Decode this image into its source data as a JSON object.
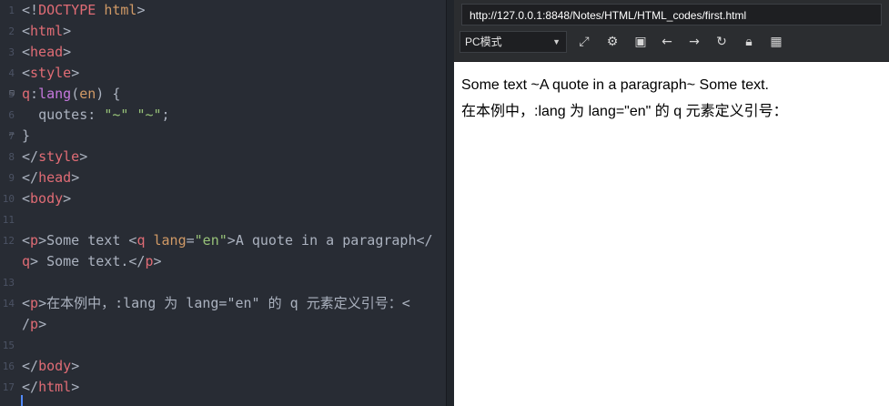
{
  "editor": {
    "lines": [
      {
        "n": "1",
        "html": "<span class='pun'>&lt;!</span><span class='tag'>DOCTYPE</span> <span class='attr'>html</span><span class='pun'>&gt;</span>"
      },
      {
        "n": "2",
        "html": "<span class='pun'>&lt;</span><span class='tag'>html</span><span class='pun'>&gt;</span>"
      },
      {
        "n": "3",
        "html": "<span class='pun'>&lt;</span><span class='tag'>head</span><span class='pun'>&gt;</span>"
      },
      {
        "n": "4",
        "html": "<span class='pun'>&lt;</span><span class='tag'>style</span><span class='pun'>&gt;</span>"
      },
      {
        "n": "5",
        "html": "<span class='tag'>q</span><span class='pun'>:</span><span class='kw'>lang</span><span class='pun'>(</span><span class='attr'>en</span><span class='pun'>) {</span>"
      },
      {
        "n": "6",
        "html": "  <span class='prop'>quotes</span><span class='pun'>: </span><span class='str'>\"~\"</span> <span class='str'>\"~\"</span><span class='pun'>;</span>"
      },
      {
        "n": "7",
        "html": "<span class='pun'>}</span>"
      },
      {
        "n": "8",
        "html": "<span class='pun'>&lt;/</span><span class='tag'>style</span><span class='pun'>&gt;</span>"
      },
      {
        "n": "9",
        "html": "<span class='pun'>&lt;/</span><span class='tag'>head</span><span class='pun'>&gt;</span>"
      },
      {
        "n": "10",
        "html": "<span class='pun'>&lt;</span><span class='tag'>body</span><span class='pun'>&gt;</span>"
      },
      {
        "n": "11",
        "html": ""
      },
      {
        "n": "12",
        "html": "<span class='pun'>&lt;</span><span class='tag'>p</span><span class='pun'>&gt;</span><span class='txt'>Some text </span><span class='pun'>&lt;</span><span class='tag'>q</span> <span class='attr'>lang</span><span class='pun'>=</span><span class='str'>\"en\"</span><span class='pun'>&gt;</span><span class='txt'>A quote in a paragraph</span><span class='pun'>&lt;/</span>"
      },
      {
        "n": "",
        "html": "<span class='tag'>q</span><span class='pun'>&gt;</span><span class='txt'> Some text.</span><span class='pun'>&lt;/</span><span class='tag'>p</span><span class='pun'>&gt;</span>"
      },
      {
        "n": "13",
        "html": ""
      },
      {
        "n": "14",
        "html": "<span class='pun'>&lt;</span><span class='tag'>p</span><span class='pun'>&gt;</span><span class='txt'>在本例中，:lang 为 lang=\"en\" 的 q 元素定义引号：&lt;</span>"
      },
      {
        "n": "",
        "html": "<span class='pun'>/</span><span class='tag'>p</span><span class='pun'>&gt;</span>"
      },
      {
        "n": "15",
        "html": ""
      },
      {
        "n": "16",
        "html": "<span class='pun'>&lt;/</span><span class='tag'>body</span><span class='pun'>&gt;</span>"
      },
      {
        "n": "17",
        "html": "<span class='pun'>&lt;/</span><span class='tag'>html</span><span class='pun'>&gt;</span>"
      }
    ]
  },
  "browser": {
    "url": "http://127.0.0.1:8848/Notes/HTML/HTML_codes/first.html",
    "mode": "PC模式",
    "toolbar_icons": [
      "expand-icon",
      "gear-icon",
      "terminal-icon",
      "back-arrow-icon",
      "forward-arrow-icon",
      "refresh-icon",
      "lock-icon",
      "qrcode-icon"
    ],
    "content": {
      "p1": "Some text ~A quote in a paragraph~ Some text.",
      "p2": "在本例中，:lang 为 lang=\"en\" 的 q 元素定义引号："
    }
  }
}
